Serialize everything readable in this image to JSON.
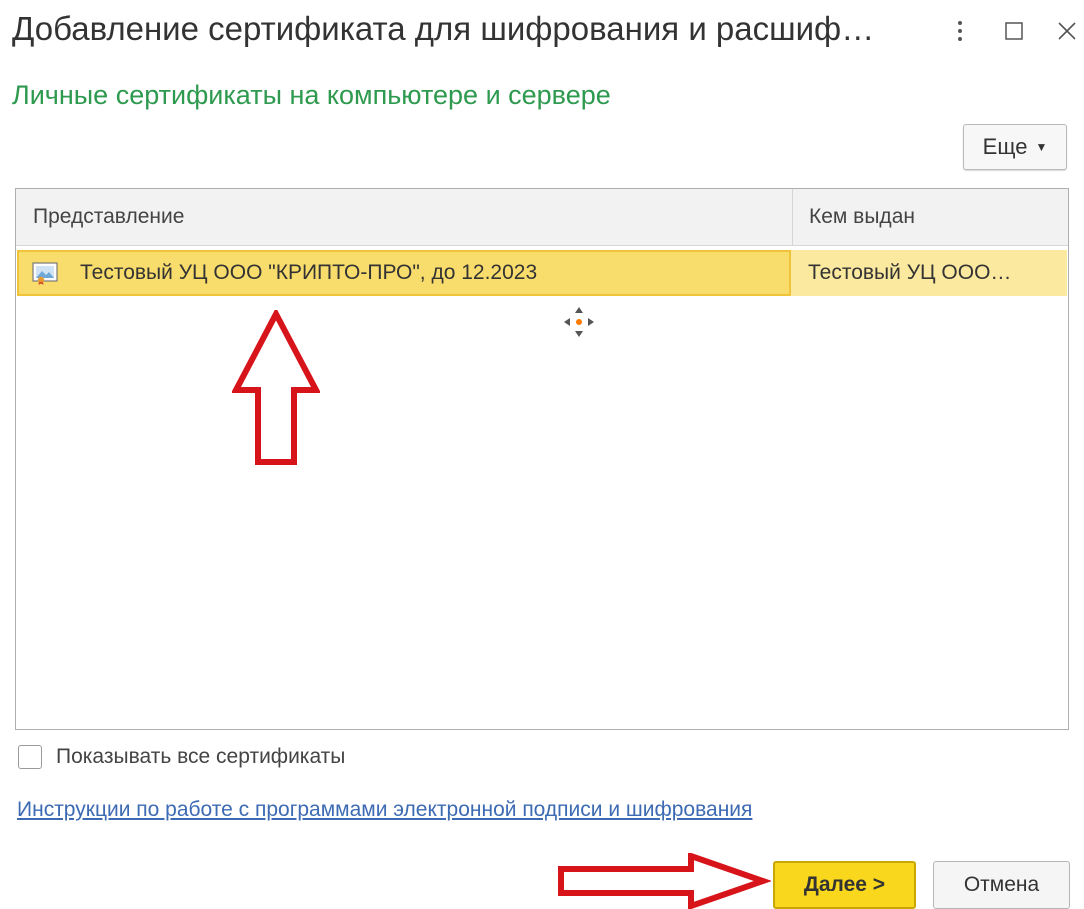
{
  "window": {
    "title": "Добавление сертификата для шифрования и расшиф…",
    "more_icon": "kebab-menu-icon",
    "maximize_icon": "maximize-icon",
    "close_icon": "close-icon"
  },
  "subtitle": "Личные сертификаты на компьютере и сервере",
  "toolbar": {
    "more_label": "Еще"
  },
  "table": {
    "columns": [
      "Представление",
      "Кем выдан"
    ],
    "rows": [
      {
        "icon": "certificate-icon",
        "name": "Тестовый УЦ ООО \"КРИПТО-ПРО\", до 12.2023",
        "issuer": "Тестовый УЦ ООО…",
        "selected": true
      }
    ]
  },
  "show_all": {
    "label": "Показывать все сертификаты",
    "checked": false
  },
  "instructions_link": "Инструкции по работе с программами электронной подписи и шифрования",
  "buttons": {
    "next": "Далее >",
    "cancel": "Отмена"
  },
  "colors": {
    "accent_green": "#2e9a4f",
    "selection_yellow": "#f9dd6c",
    "primary_button": "#f9d71c",
    "link_blue": "#3d6bb3",
    "annotation_red": "#d8141b"
  }
}
